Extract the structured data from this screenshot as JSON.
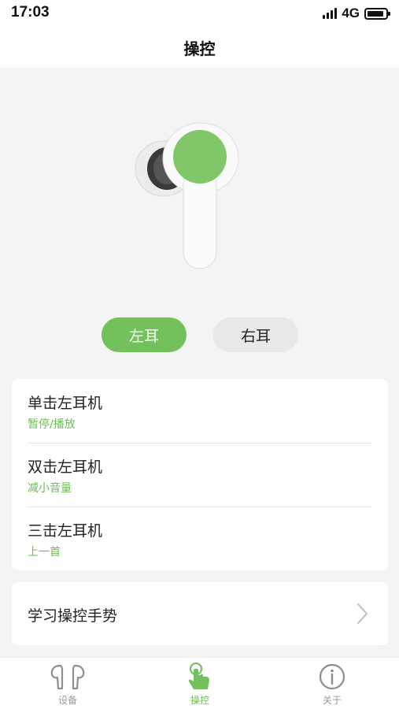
{
  "status_bar": {
    "time": "17:03",
    "network": "4G",
    "battery_level": 0.9
  },
  "header": {
    "title": "操控"
  },
  "ear_selector": {
    "left_label": "左耳",
    "right_label": "右耳",
    "selected": "left"
  },
  "actions": [
    {
      "title": "单击左耳机",
      "value": "暂停/播放"
    },
    {
      "title": "双击左耳机",
      "value": "减小音量"
    },
    {
      "title": "三击左耳机",
      "value": "上一首"
    }
  ],
  "learn": {
    "label": "学习操控手势",
    "icon": "chevron-right-icon"
  },
  "tab_bar": {
    "items": [
      {
        "label": "设备",
        "icon": "earbuds-icon",
        "active": false
      },
      {
        "label": "操控",
        "icon": "touch-hand-icon",
        "active": true
      },
      {
        "label": "关于",
        "icon": "info-icon",
        "active": false
      }
    ]
  },
  "colors": {
    "accent": "#72c15a",
    "accent_text": "#6cbd52",
    "background": "#f4f4f4",
    "card": "#ffffff"
  }
}
